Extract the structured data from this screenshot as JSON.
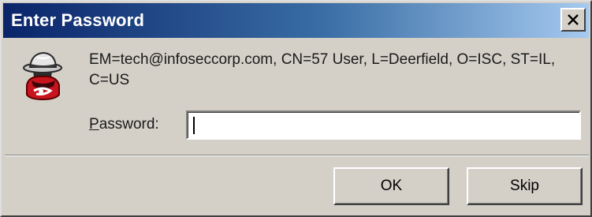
{
  "window": {
    "title": "Enter Password",
    "close_icon": "close-icon"
  },
  "content": {
    "icon": "spy-hat-icon",
    "subject": "EM=tech@infoseccorp.com, CN=57 User, L=Deerfield, O=ISC, ST=IL, C=US",
    "password_label_accel": "P",
    "password_label_rest": "assword:",
    "password_value": "",
    "password_placeholder": ""
  },
  "buttons": {
    "ok_label": "OK",
    "skip_label": "Skip"
  },
  "colors": {
    "dialog_face": "#d4d0c8",
    "titlebar_start": "#0a246a",
    "titlebar_end": "#a6caf0",
    "title_text": "#ffffff",
    "icon_red": "#c8141e"
  }
}
